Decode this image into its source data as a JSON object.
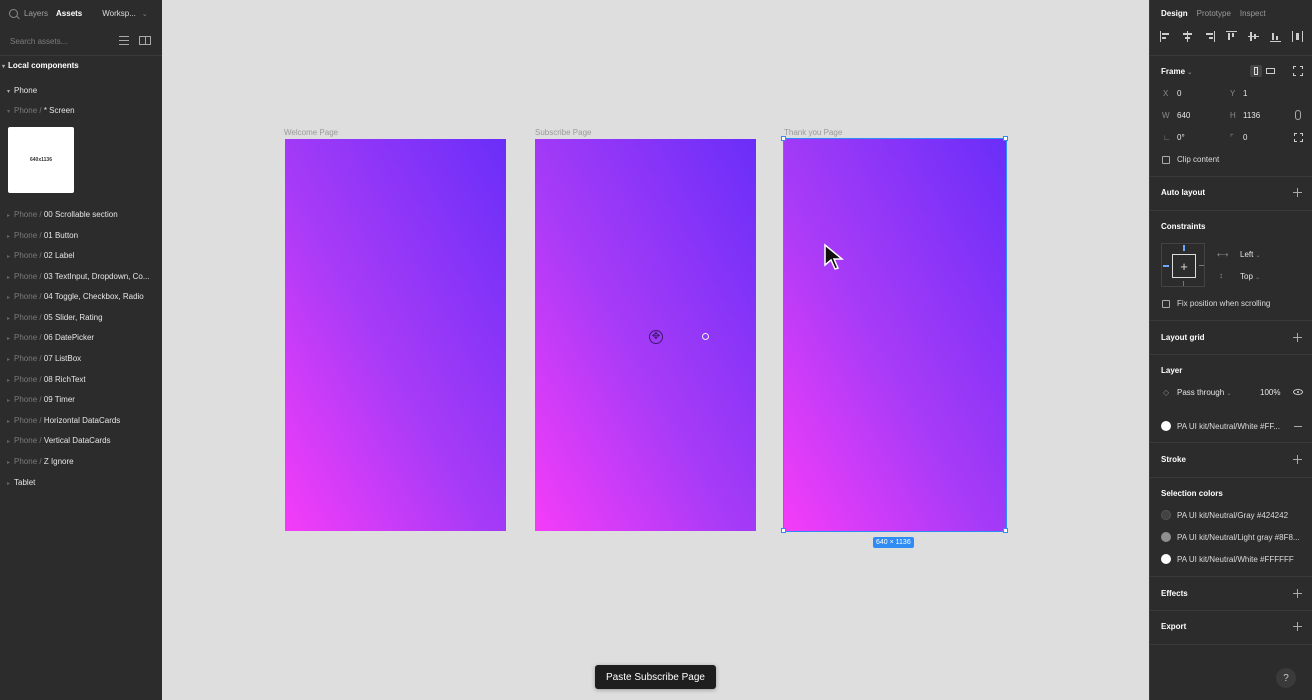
{
  "left_panel": {
    "tabs": [
      "Layers",
      "Assets"
    ],
    "workspace": "Worksp...",
    "search_placeholder": "Search assets...",
    "section_title": "Local components",
    "group_phone": "Phone",
    "screen_row": {
      "prefix": "Phone /",
      "name": "* Screen"
    },
    "thumbnail_text": "640x1136",
    "components": [
      {
        "prefix": "Phone /",
        "name": "00 Scrollable section"
      },
      {
        "prefix": "Phone /",
        "name": "01 Button"
      },
      {
        "prefix": "Phone /",
        "name": "02 Label"
      },
      {
        "prefix": "Phone /",
        "name": "03 TextInput, Dropdown, Co..."
      },
      {
        "prefix": "Phone /",
        "name": "04 Toggle, Checkbox, Radio"
      },
      {
        "prefix": "Phone /",
        "name": "05 Slider, Rating"
      },
      {
        "prefix": "Phone /",
        "name": "06 DatePicker"
      },
      {
        "prefix": "Phone /",
        "name": "07 ListBox"
      },
      {
        "prefix": "Phone /",
        "name": "08 RichText"
      },
      {
        "prefix": "Phone /",
        "name": "09 Timer"
      },
      {
        "prefix": "Phone /",
        "name": "Horizontal DataCards"
      },
      {
        "prefix": "Phone /",
        "name": "Vertical DataCards"
      },
      {
        "prefix": "Phone /",
        "name": "Z Ignore"
      }
    ],
    "group_tablet": "Tablet"
  },
  "canvas": {
    "frames": [
      {
        "label": "Welcome Page"
      },
      {
        "label": "Subscribe Page"
      },
      {
        "label": "Thank you Page"
      }
    ],
    "selection_size": "640 × 1136",
    "toast": "Paste Subscribe Page",
    "gradient_colors": [
      "#f53cf8",
      "#a73bf7",
      "#6a2ef8"
    ],
    "selection_color": "#2f8cf5"
  },
  "right_panel": {
    "tabs": [
      "Design",
      "Prototype",
      "Inspect"
    ],
    "frame_label": "Frame",
    "x_label": "X",
    "x_value": "0",
    "y_label": "Y",
    "y_value": "1",
    "w_label": "W",
    "w_value": "640",
    "h_label": "H",
    "h_value": "1136",
    "rotation_value": "0°",
    "radius_value": "0",
    "clip_content": "Clip content",
    "auto_layout": "Auto layout",
    "constraints": "Constraints",
    "constraint_h": "Left",
    "constraint_v": "Top",
    "fix_position": "Fix position when scrolling",
    "layout_grid": "Layout grid",
    "layer": "Layer",
    "blend_mode": "Pass through",
    "opacity": "100%",
    "fill_style": "PA UI kit/Neutral/White #FF...",
    "stroke": "Stroke",
    "selection_colors": "Selection colors",
    "colors": [
      {
        "name": "PA UI kit/Neutral/Gray #424242",
        "hex": "#424242"
      },
      {
        "name": "PA UI kit/Neutral/Light gray #8F8...",
        "hex": "#8f8f8f"
      },
      {
        "name": "PA UI kit/Neutral/White #FFFFFF",
        "hex": "#ffffff"
      }
    ],
    "effects": "Effects",
    "export": "Export",
    "help": "?"
  }
}
